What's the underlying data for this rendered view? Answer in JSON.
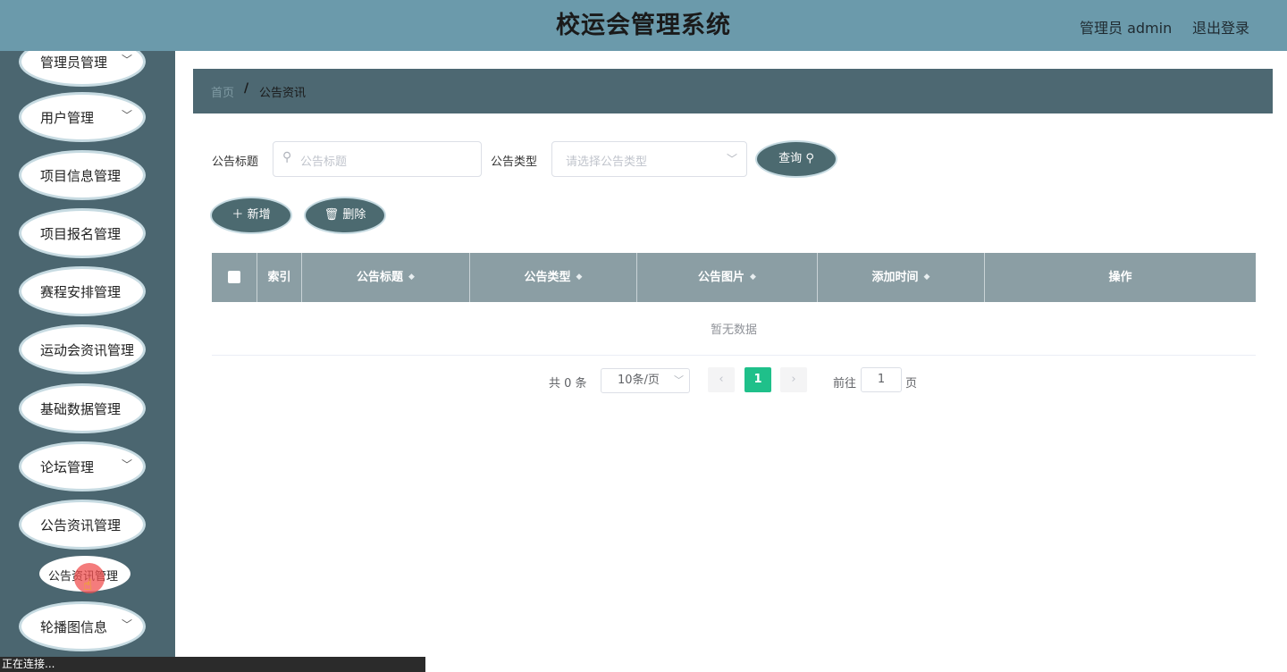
{
  "header": {
    "title": "校运会管理系统",
    "user": "管理员 admin",
    "logout": "退出登录"
  },
  "sidebar": {
    "items": [
      {
        "label": "管理员管理"
      },
      {
        "label": "用户管理"
      },
      {
        "label": "项目信息管理"
      },
      {
        "label": "项目报名管理"
      },
      {
        "label": "赛程安排管理"
      },
      {
        "label": "运动会资讯管理"
      },
      {
        "label": "基础数据管理"
      },
      {
        "label": "论坛管理"
      },
      {
        "label": "公告资讯管理"
      },
      {
        "label": "轮播图信息"
      }
    ],
    "sub_item": "公告资讯管理"
  },
  "breadcrumb": {
    "home": "首页",
    "separator": "/",
    "current": "公告资讯"
  },
  "search": {
    "title_label": "公告标题",
    "title_placeholder": "公告标题",
    "type_label": "公告类型",
    "type_placeholder": "请选择公告类型",
    "query_button": "查询"
  },
  "actions": {
    "add": "新增",
    "delete": "删除"
  },
  "table": {
    "columns": [
      "索引",
      "公告标题",
      "公告类型",
      "公告图片",
      "添加时间",
      "操作"
    ],
    "empty_text": "暂无数据"
  },
  "pagination": {
    "total": "共 0 条",
    "page_size": "10条/页",
    "current_page": "1",
    "goto_label": "前往",
    "goto_value": "1",
    "goto_unit": "页"
  },
  "statusbar": {
    "text": "正在连接..."
  },
  "colors": {
    "header_bg": "#6b9aab",
    "sidebar_bg": "#4b6670",
    "breadcrumb_bg": "#4d6872",
    "button_bg": "#4c6a70",
    "table_header_bg": "#8b9ea4",
    "pagination_active": "#1fc08a"
  }
}
